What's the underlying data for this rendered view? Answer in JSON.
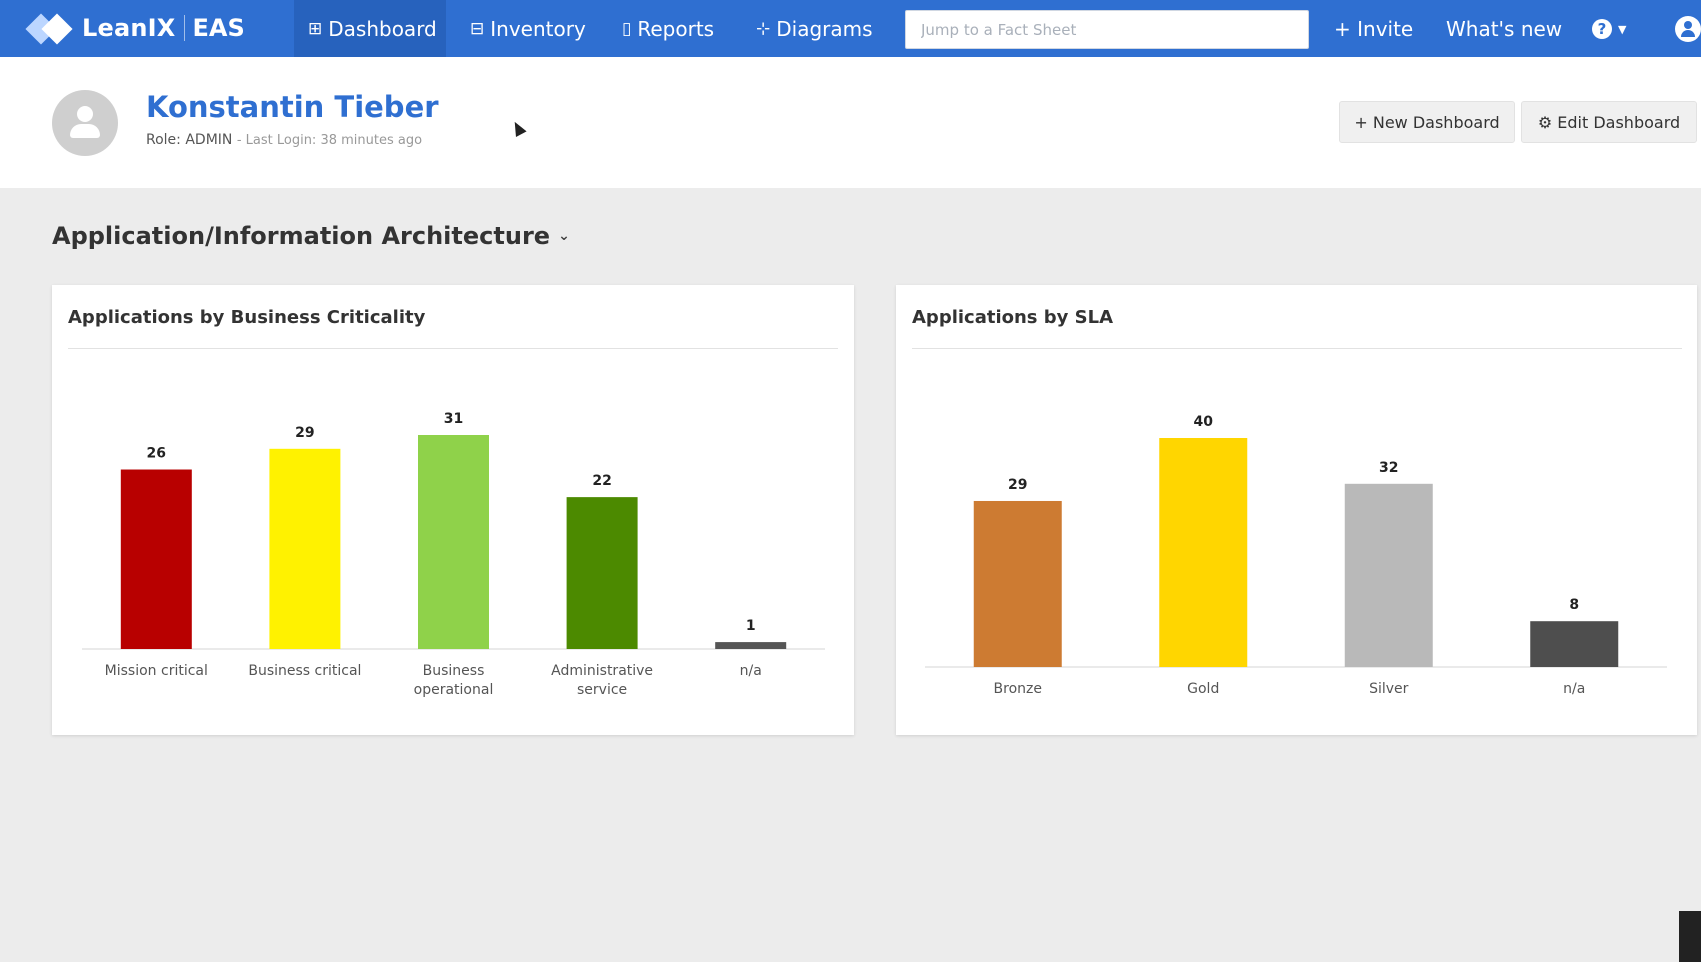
{
  "nav": {
    "brand": "LeanIX",
    "product": "EAS",
    "items": [
      {
        "label": "Dashboard",
        "icon": "dashboard-icon",
        "glyph": "⊞",
        "active": true
      },
      {
        "label": "Inventory",
        "icon": "inventory-icon",
        "glyph": "⊟",
        "active": false
      },
      {
        "label": "Reports",
        "icon": "reports-icon",
        "glyph": "▯",
        "active": false
      },
      {
        "label": "Diagrams",
        "icon": "diagrams-icon",
        "glyph": "⊹",
        "active": false
      }
    ],
    "search_placeholder": "Jump to a Fact Sheet",
    "invite_label": "+ Invite",
    "whats_new_label": "What's new",
    "help_glyph": "?"
  },
  "profile": {
    "name": "Konstantin Tieber",
    "role": "Role: ADMIN",
    "last_login": "- Last Login: 38 minutes ago",
    "new_dashboard_label": "+ New Dashboard",
    "edit_dashboard_label": "⚙ Edit Dashboard"
  },
  "section": {
    "title": "Application/Information Architecture"
  },
  "chart_data": [
    {
      "type": "bar",
      "title": "Applications by Business Criticality",
      "categories": [
        "Mission critical",
        "Business critical",
        "Business operational",
        "Administrative service",
        "n/a"
      ],
      "values": [
        26,
        29,
        31,
        22,
        1
      ],
      "colors": [
        "#b80000",
        "#fff200",
        "#8fd24a",
        "#4c8a00",
        "#555555"
      ],
      "data_labels": true,
      "grid": false
    },
    {
      "type": "bar",
      "title": "Applications by SLA",
      "categories": [
        "Bronze",
        "Gold",
        "Silver",
        "n/a"
      ],
      "values": [
        29,
        40,
        32,
        8
      ],
      "colors": [
        "#cd7b32",
        "#ffd600",
        "#b9b9b9",
        "#4e4e4e"
      ],
      "data_labels": true,
      "grid": false
    }
  ]
}
